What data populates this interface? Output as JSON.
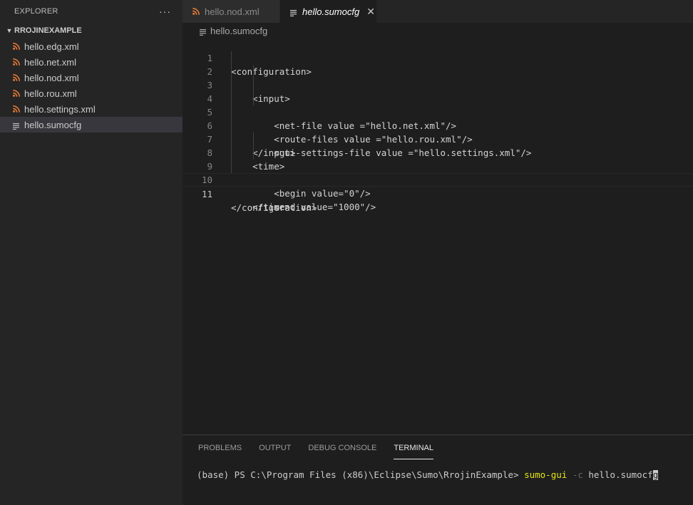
{
  "sidebar": {
    "title": "EXPLORER",
    "more": "···",
    "folder": "RROJINEXAMPLE",
    "files": [
      {
        "name": "hello.edg.xml",
        "icon": "rss-icon",
        "selected": false
      },
      {
        "name": "hello.net.xml",
        "icon": "rss-icon",
        "selected": false
      },
      {
        "name": "hello.nod.xml",
        "icon": "rss-icon",
        "selected": false
      },
      {
        "name": "hello.rou.xml",
        "icon": "rss-icon",
        "selected": false
      },
      {
        "name": "hello.settings.xml",
        "icon": "rss-icon",
        "selected": false
      },
      {
        "name": "hello.sumocfg",
        "icon": "lines-icon",
        "selected": true
      }
    ]
  },
  "tabs": [
    {
      "label": "hello.nod.xml",
      "icon": "rss-icon",
      "active": false
    },
    {
      "label": "hello.sumocfg",
      "icon": "lines-icon",
      "active": true,
      "close": "✕"
    }
  ],
  "breadcrumb": "hello.sumocfg",
  "code": {
    "current_line": 11,
    "lines": [
      {
        "num": "1",
        "text": "<configuration>"
      },
      {
        "num": "2",
        "text": "    <input>"
      },
      {
        "num": "3",
        "text": "        <net-file value =\"hello.net.xml\"/>"
      },
      {
        "num": "4",
        "text": "        <route-files value =\"hello.rou.xml\"/>"
      },
      {
        "num": "5",
        "text": "        <gui-settings-file value =\"hello.settings.xml\"/>"
      },
      {
        "num": "6",
        "text": "    </input>"
      },
      {
        "num": "7",
        "text": "    <time>"
      },
      {
        "num": "8",
        "text": "        <begin value=\"0\"/>"
      },
      {
        "num": "9",
        "text": "        <end value=\"1000\"/>"
      },
      {
        "num": "10",
        "text": "    </time>"
      },
      {
        "num": "11",
        "text": "</configuration>"
      }
    ]
  },
  "panel": {
    "tabs": [
      "PROBLEMS",
      "OUTPUT",
      "DEBUG CONSOLE",
      "TERMINAL"
    ],
    "active_tab": "TERMINAL",
    "terminal": {
      "prompt": "(base) PS C:\\Program Files (x86)\\Eclipse\\Sumo\\RrojinExample> ",
      "command": "sumo-gui",
      "flag": " -c",
      "arg": " hello.sumocf",
      "tail": "g"
    }
  },
  "colors": {
    "rss_orange": "#e37933",
    "sidebar_bg": "#252526",
    "editor_bg": "#1e1e1e",
    "selected_bg": "#37373d",
    "terminal_command": "#e5e510"
  }
}
